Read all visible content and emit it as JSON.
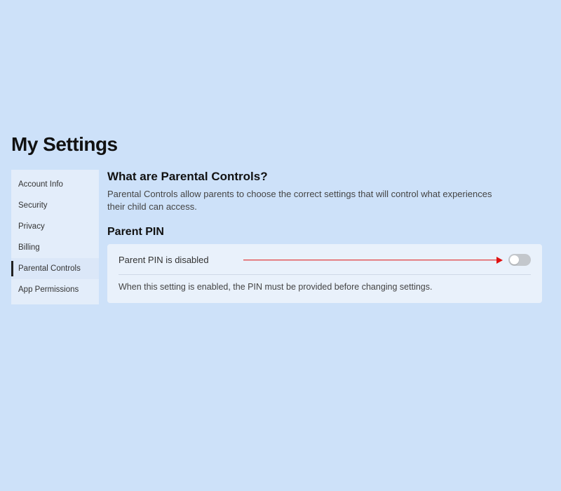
{
  "page_title": "My Settings",
  "sidebar": {
    "items": [
      {
        "label": "Account Info"
      },
      {
        "label": "Security"
      },
      {
        "label": "Privacy"
      },
      {
        "label": "Billing"
      },
      {
        "label": "Parental Controls"
      },
      {
        "label": "App Permissions"
      }
    ],
    "active_index": 4
  },
  "main": {
    "heading": "What are Parental Controls?",
    "description": "Parental Controls allow parents to choose the correct settings that will control what experiences their child can access.",
    "pin_section": {
      "heading": "Parent PIN",
      "status_text": "Parent PIN is disabled",
      "toggle_enabled": false,
      "note": "When this setting is enabled, the PIN must be provided before changing settings."
    }
  },
  "colors": {
    "page_bg": "#cde1f9",
    "sidebar_bg": "#e3edfa",
    "card_bg": "#e9f1fb",
    "accent_arrow": "#e01010",
    "toggle_off_track": "#c3c7cc"
  }
}
